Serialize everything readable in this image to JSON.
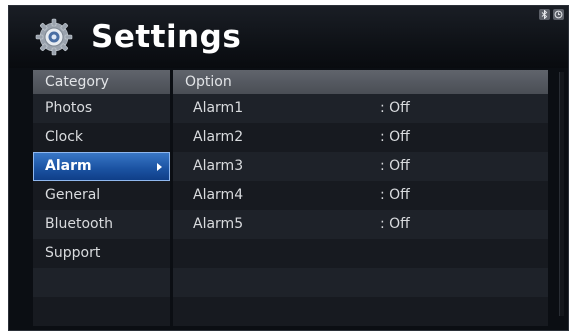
{
  "app": {
    "title": "Settings"
  },
  "category": {
    "header": "Category",
    "items": [
      {
        "label": "Photos"
      },
      {
        "label": "Clock"
      },
      {
        "label": "Alarm",
        "selected": true
      },
      {
        "label": "General"
      },
      {
        "label": "Bluetooth"
      },
      {
        "label": "Support"
      }
    ]
  },
  "option": {
    "header": "Option",
    "items": [
      {
        "label": "Alarm1",
        "value": ": Off"
      },
      {
        "label": "Alarm2",
        "value": ": Off"
      },
      {
        "label": "Alarm3",
        "value": ": Off"
      },
      {
        "label": "Alarm4",
        "value": ": Off"
      },
      {
        "label": "Alarm5",
        "value": ": Off"
      }
    ]
  },
  "status_icons": [
    "bluetooth-icon",
    "clock-icon"
  ],
  "colors": {
    "selected": "#1c54a4",
    "background": "#0b0e13",
    "header_bar": "#4a4e55"
  }
}
